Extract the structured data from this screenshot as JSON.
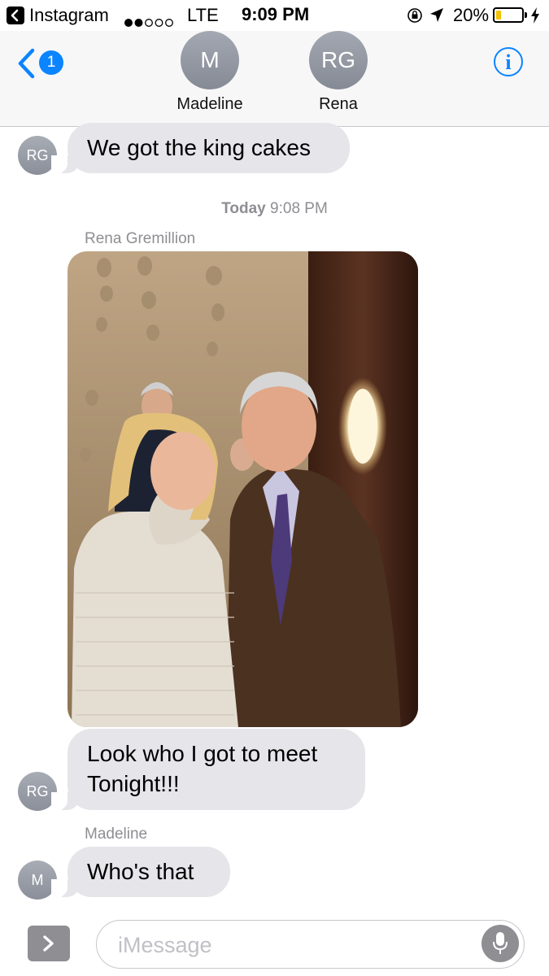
{
  "status_bar": {
    "back_app": "Instagram",
    "signal": "●●○○○",
    "network": "LTE",
    "time": "9:09 PM",
    "battery_percent": "20%",
    "battery_level": 0.2,
    "battery_color": "#f2c200",
    "icons": [
      "back-icon",
      "orientation-lock-icon",
      "location-arrow-icon",
      "battery-icon",
      "charging-bolt-icon"
    ]
  },
  "header": {
    "back_badge": "1",
    "contacts": [
      {
        "initials": "M",
        "name": "Madeline"
      },
      {
        "initials": "RG",
        "name": "Rena"
      }
    ],
    "info_label": "i",
    "accent_color": "#0b84ff"
  },
  "messages": [
    {
      "avatar": "RG",
      "text": "We got the king cakes"
    },
    {
      "timestamp_day": "Today",
      "timestamp_time": "9:08 PM"
    },
    {
      "sender": "Rena Gremillion",
      "type": "photo"
    },
    {
      "avatar": "RG",
      "text_line1": "Look who I got to meet",
      "text_line2": "Tonight!!!"
    },
    {
      "sender": "Madeline",
      "avatar": "M",
      "text": "Who's that"
    }
  ],
  "composer": {
    "placeholder": "iMessage",
    "value": "",
    "icons": [
      "chevron-right-icon",
      "microphone-icon"
    ]
  }
}
